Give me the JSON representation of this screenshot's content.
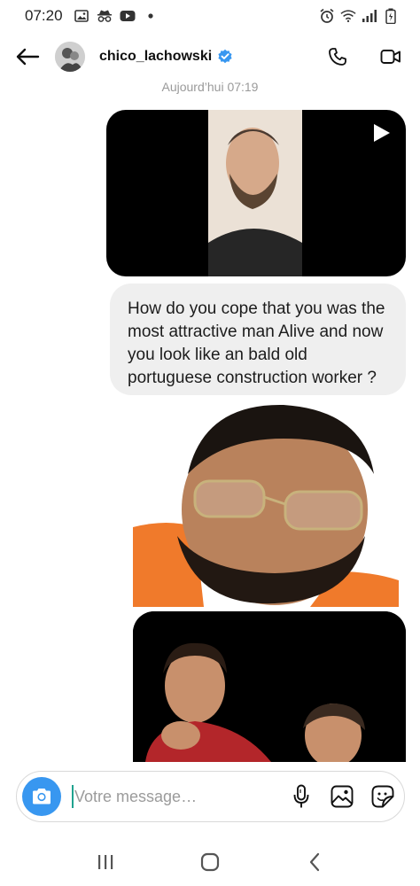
{
  "status_bar": {
    "time": "07:20",
    "left_icons": [
      "image-icon",
      "incognito-icon",
      "youtube-icon",
      "dot-icon"
    ],
    "right_icons": [
      "alarm-icon",
      "wifi-icon",
      "signal-icon",
      "battery-icon"
    ]
  },
  "header": {
    "username": "chico_lachowski",
    "verified": true,
    "accent_color": "#3897f0"
  },
  "thread": {
    "timestamp": "Aujourd’hui 07:19",
    "messages": [
      {
        "type": "video",
        "icon": "play-icon"
      },
      {
        "type": "text",
        "text": "How do you cope that you was the most attractive man Alive and now you look like an bald old portuguese construction worker ?"
      },
      {
        "type": "sticker"
      },
      {
        "type": "image"
      }
    ]
  },
  "composer": {
    "placeholder": "Votre message…",
    "value": "",
    "icons": [
      "camera-icon",
      "microphone-icon",
      "gallery-icon",
      "sticker-icon"
    ]
  },
  "nav": {
    "icons": [
      "recent-apps-icon",
      "home-icon",
      "back-icon"
    ]
  }
}
